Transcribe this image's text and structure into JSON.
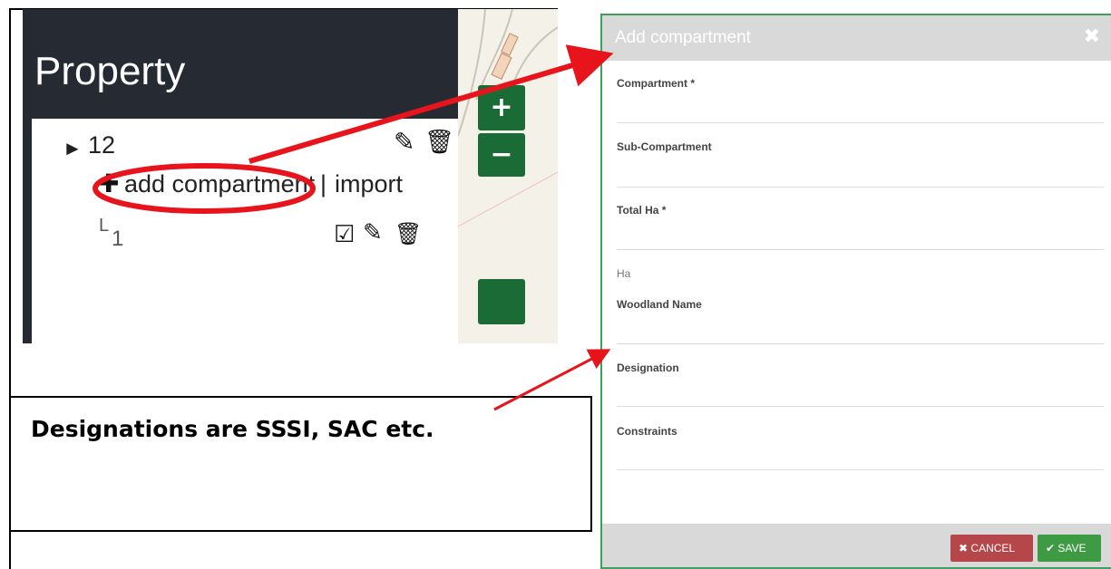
{
  "left_panel": {
    "title": "Property",
    "tree": {
      "root_arrow": "►",
      "root_label": "12",
      "add_label": "add compartment",
      "separator": "|",
      "import_label": "import",
      "child_prefix": "L",
      "child_label": "1"
    },
    "map_controls": {
      "zoom_in": "+",
      "zoom_out": "−"
    }
  },
  "note": {
    "text": "Designations are SSSI, SAC etc."
  },
  "modal": {
    "title": "Add compartment",
    "close_symbol": "✖",
    "fields": {
      "compartment": "Compartment *",
      "sub_compartment": "Sub-Compartment",
      "total_ha": "Total Ha *",
      "total_ha_helper": "Ha",
      "woodland_name": "Woodland Name",
      "designation": "Designation",
      "constraints": "Constraints"
    },
    "buttons": {
      "cancel": "CANCEL",
      "save": "SAVE"
    }
  },
  "colors": {
    "dark_panel": "#262b33",
    "map_button": "#1b6b37",
    "modal_border": "#3aa05a",
    "cancel": "#b5474b",
    "save": "#3f9a44",
    "annotation": "#e8141b"
  }
}
